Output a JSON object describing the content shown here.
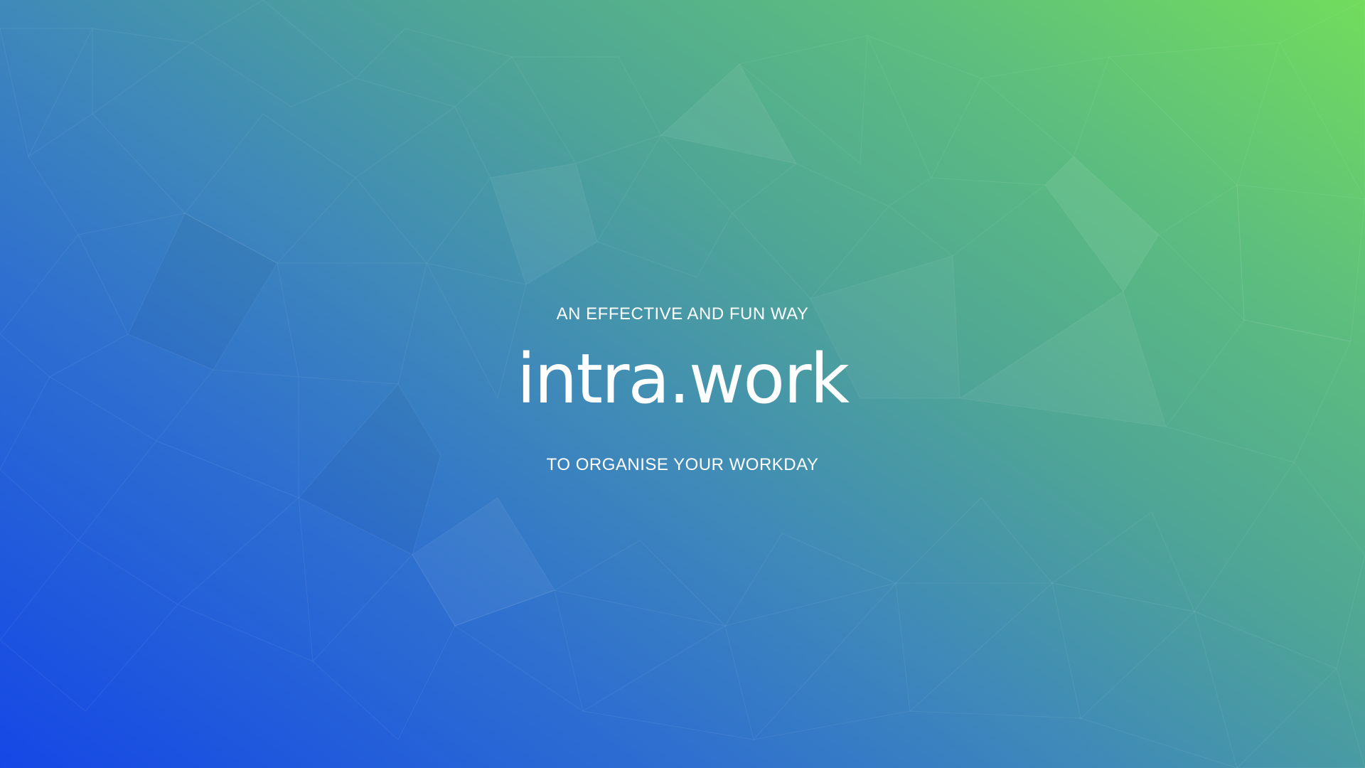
{
  "hero": {
    "tagline_top": "AN EFFECTIVE AND FUN WAY",
    "logo_text": "intra.work",
    "tagline_bottom": "TO ORGANISE YOUR WORKDAY"
  },
  "colors": {
    "gradient_blue": "#1547e6",
    "gradient_teal": "#4fa596",
    "gradient_green": "#72dc5c",
    "text": "#ffffff"
  }
}
